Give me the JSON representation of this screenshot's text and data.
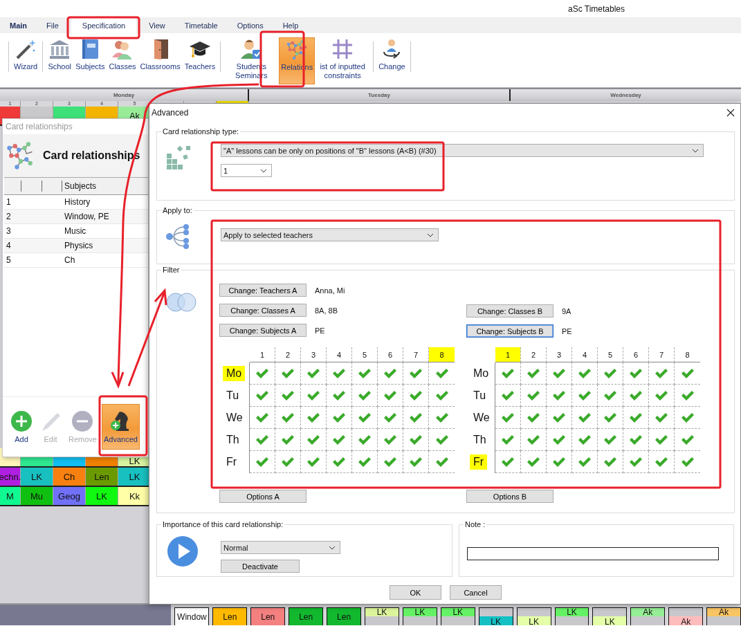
{
  "window": {
    "title": "aSc Timetables"
  },
  "menu": [
    {
      "label": "Main",
      "kind": "home",
      "selected": false
    },
    {
      "label": "File",
      "kind": "tab",
      "selected": false
    },
    {
      "label": "Specification",
      "kind": "tab",
      "selected": true
    },
    {
      "label": "View",
      "kind": "tab",
      "selected": false
    },
    {
      "label": "Timetable",
      "kind": "tab",
      "selected": false
    },
    {
      "label": "Options",
      "kind": "tab",
      "selected": false
    },
    {
      "label": "Help",
      "kind": "tab",
      "selected": false
    }
  ],
  "ribbon": [
    [
      {
        "label": "Wizard",
        "kind": "wand",
        "selected": false
      }
    ],
    [
      {
        "label": "School",
        "kind": "building",
        "selected": false
      },
      {
        "label": "Subjects",
        "kind": "book",
        "selected": false
      },
      {
        "label": "Classes",
        "kind": "people",
        "selected": false
      },
      {
        "label": "Classrooms",
        "kind": "door",
        "selected": false
      },
      {
        "label": "Teachers",
        "kind": "cap",
        "selected": false
      }
    ],
    [
      {
        "label": "Students Seminars",
        "kind": "student",
        "selected": false
      },
      {
        "label": "Relations",
        "kind": "network",
        "selected": true
      },
      {
        "label": "ist of inputted constraints",
        "kind": "grid",
        "selected": false
      }
    ],
    [
      {
        "label": "Change",
        "kind": "swap",
        "selected": false
      }
    ]
  ],
  "timetable": {
    "days": [
      "Monday",
      "Tuesday",
      "Wednesday"
    ],
    "periods": [
      {
        "label": "1",
        "highlighted": false
      },
      {
        "label": "2",
        "highlighted": false
      },
      {
        "label": "3",
        "highlighted": false
      },
      {
        "label": "4",
        "highlighted": false
      },
      {
        "label": "5",
        "highlighted": false
      },
      {
        "highlighted": false
      },
      {
        "highlighted": false
      },
      {
        "highlighted": true
      }
    ],
    "top_row": [
      {
        "color": "#f03a3a"
      },
      {
        "color": "#c9c9cc"
      },
      {
        "color": "#3ee07a"
      },
      {
        "color": "#f2b400"
      },
      {
        "color": "#98ec98",
        "label": "Ak"
      }
    ],
    "bottom_rows": [
      [
        {
          "color": "#fff6b8"
        },
        {
          "color": "#2ee890"
        },
        {
          "color": "#10c0f0"
        },
        {
          "color": "#f08000"
        },
        {
          "color": "#d8f4a0",
          "label": "LK"
        }
      ],
      [
        {
          "color": "#b020e0",
          "label": "echn."
        },
        {
          "color": "#18c0c0",
          "label": "LK"
        },
        {
          "color": "#f88010",
          "label": "Ch"
        },
        {
          "color": "#6a9a00",
          "label": "Len"
        },
        {
          "color": "#18c0c0",
          "label": "LK"
        }
      ],
      [
        {
          "color": "#10f890",
          "label": "M"
        },
        {
          "color": "#10c010",
          "label": "Mu"
        },
        {
          "color": "#7070f8",
          "label": "Geog"
        },
        {
          "color": "#10f810",
          "label": "LK"
        },
        {
          "color": "#ffffa8",
          "label": "Kk"
        }
      ]
    ]
  },
  "bottom_strip": [
    {
      "label": "Window",
      "color": "#ffffff",
      "kind": "full"
    },
    {
      "label": "Len",
      "color": "#ffba00",
      "kind": "full"
    },
    {
      "label": "Len",
      "color": "#f48080",
      "kind": "full"
    },
    {
      "label": "Len",
      "color": "#12b82e",
      "kind": "full"
    },
    {
      "label": "Len",
      "color": "#12b82e",
      "kind": "full"
    },
    {
      "label": "LK",
      "color": "#dcf49c",
      "kind": "top"
    },
    {
      "label": "LK",
      "color": "#66f266",
      "kind": "top"
    },
    {
      "label": "LK",
      "color": "#66f266",
      "kind": "top"
    },
    {
      "label": "LK",
      "color": "#14c0c4",
      "kind": "low"
    },
    {
      "label": "LK",
      "color": "#e4ffa8",
      "kind": "low"
    },
    {
      "label": "LK",
      "color": "#66f266",
      "kind": "top"
    },
    {
      "label": "LK",
      "color": "#e4ffa8",
      "kind": "low"
    },
    {
      "label": "Ak",
      "color": "#96ee96",
      "kind": "top"
    },
    {
      "label": "Ak",
      "color": "#ffbcbc",
      "kind": "low"
    },
    {
      "label": "Ak",
      "color": "#f8c464",
      "kind": "top"
    }
  ],
  "card_panel": {
    "title": "Card relationships",
    "heading": "Card relationships",
    "column": "Subjects",
    "rows": [
      {
        "number": "1",
        "subjects": "History"
      },
      {
        "number": "2",
        "subjects": "Window, PE"
      },
      {
        "number": "3",
        "subjects": "Music"
      },
      {
        "number": "4",
        "subjects": "Physics"
      },
      {
        "number": "5",
        "subjects": "Ch"
      }
    ],
    "toolbar": [
      {
        "label": "Add",
        "kind": "add",
        "disabled": false,
        "selected": false
      },
      {
        "label": "Edit",
        "kind": "edit",
        "disabled": true,
        "selected": false
      },
      {
        "label": "Remove",
        "kind": "remove",
        "disabled": true,
        "selected": false
      },
      {
        "label": "Advanced",
        "kind": "advanced",
        "disabled": false,
        "selected": true
      }
    ]
  },
  "dialog": {
    "title": "Advanced",
    "type_group": {
      "label": "Card relationship type:",
      "type": "\"A\" lessons can be only on positions of \"B\" lessons (A<B) (#30)",
      "count": "1"
    },
    "apply_group": {
      "label": "Apply to:",
      "value": "Apply to selected teachers"
    },
    "filter": {
      "label": "Filter",
      "side_a": [
        {
          "button": "Change: Teachers A",
          "value": "Anna, Mi",
          "focused": false
        },
        {
          "button": "Change: Classes A",
          "value": "8A, 8B",
          "focused": false
        },
        {
          "button": "Change: Subjects A",
          "value": "PE",
          "focused": false
        }
      ],
      "side_b": [
        {
          "button": "Change: Classes B",
          "value": "9A",
          "focused": false
        },
        {
          "button": "Change: Subjects B",
          "value": "PE",
          "focused": true
        }
      ],
      "grids": [
        {
          "options_button": "Options A",
          "periods": [
            {
              "label": "1",
              "highlighted": false
            },
            {
              "label": "2",
              "highlighted": false
            },
            {
              "label": "3",
              "highlighted": false
            },
            {
              "label": "4",
              "highlighted": false
            },
            {
              "label": "5",
              "highlighted": false
            },
            {
              "label": "6",
              "highlighted": false
            },
            {
              "label": "7",
              "highlighted": false
            },
            {
              "label": "8",
              "highlighted": true
            }
          ],
          "days": [
            {
              "label": "Mo",
              "highlighted": true,
              "checked": [
                true,
                true,
                true,
                true,
                true,
                true,
                true,
                true
              ]
            },
            {
              "label": "Tu",
              "highlighted": false,
              "checked": [
                true,
                true,
                true,
                true,
                true,
                true,
                true,
                true
              ]
            },
            {
              "label": "We",
              "highlighted": false,
              "checked": [
                true,
                true,
                true,
                true,
                true,
                true,
                true,
                true
              ]
            },
            {
              "label": "Th",
              "highlighted": false,
              "checked": [
                true,
                true,
                true,
                true,
                true,
                true,
                true,
                true
              ]
            },
            {
              "label": "Fr",
              "highlighted": false,
              "checked": [
                true,
                true,
                true,
                true,
                true,
                true,
                true,
                true
              ]
            }
          ]
        },
        {
          "options_button": "Options B",
          "periods": [
            {
              "label": "1",
              "highlighted": true
            },
            {
              "label": "2",
              "highlighted": false
            },
            {
              "label": "3",
              "highlighted": false
            },
            {
              "label": "4",
              "highlighted": false
            },
            {
              "label": "5",
              "highlighted": false
            },
            {
              "label": "6",
              "highlighted": false
            },
            {
              "label": "7",
              "highlighted": false
            },
            {
              "label": "8",
              "highlighted": false
            }
          ],
          "days": [
            {
              "label": "Mo",
              "highlighted": false,
              "checked": [
                true,
                true,
                true,
                true,
                true,
                true,
                true,
                true
              ]
            },
            {
              "label": "Tu",
              "highlighted": false,
              "checked": [
                true,
                true,
                true,
                true,
                true,
                true,
                true,
                true
              ]
            },
            {
              "label": "We",
              "highlighted": false,
              "checked": [
                true,
                true,
                true,
                true,
                true,
                true,
                true,
                true
              ]
            },
            {
              "label": "Th",
              "highlighted": false,
              "checked": [
                true,
                true,
                true,
                true,
                true,
                true,
                true,
                true
              ]
            },
            {
              "label": "Fr",
              "highlighted": true,
              "checked": [
                true,
                true,
                true,
                true,
                true,
                true,
                true,
                true
              ]
            }
          ]
        }
      ]
    },
    "importance_group": {
      "label": "Importance of this card relationship:",
      "value": "Normal",
      "button": "Deactivate"
    },
    "note_group": {
      "label": "Note :"
    },
    "buttons": [
      "OK",
      "Cancel"
    ]
  }
}
